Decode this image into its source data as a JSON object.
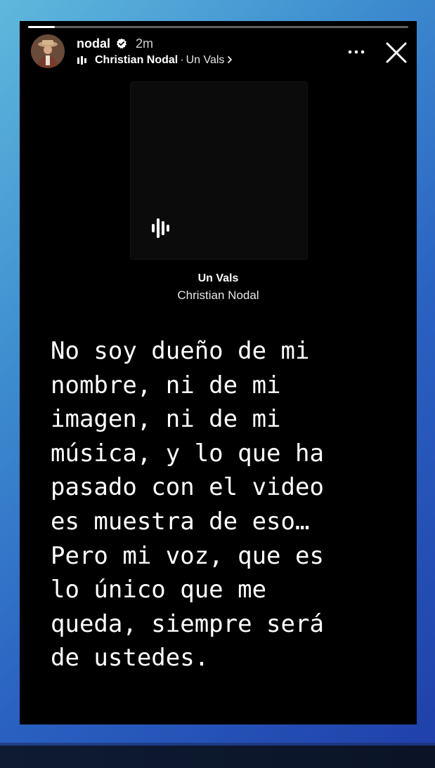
{
  "story": {
    "username": "nodal",
    "verified_icon": "verified-badge-icon",
    "time_ago": "2m",
    "progress": 0.07,
    "music": {
      "artist": "Christian Nodal",
      "separator": "·",
      "song": "Un Vals",
      "bars_icon": "music-bars-icon",
      "chevron_icon": "chevron-right-icon"
    },
    "actions": {
      "more_icon": "more-dots-icon",
      "close_icon": "close-icon"
    }
  },
  "music_sticker": {
    "title": "Un Vals",
    "artist": "Christian Nodal",
    "bars_icon": "music-bars-icon"
  },
  "message": {
    "text": "No soy dueño de mi\nnombre, ni de mi\nimagen, ni de mi\nmúsica, y lo que ha\npasado con el video\nes muestra de eso…\nPero mi voz, que es\nlo único que me\nqueda, siempre será\nde ustedes."
  },
  "colors": {
    "story_background": "#000000",
    "text": "#ffffff",
    "outer_gradient_start": "#5fb8dc",
    "outer_gradient_end": "#1f3fa8"
  }
}
